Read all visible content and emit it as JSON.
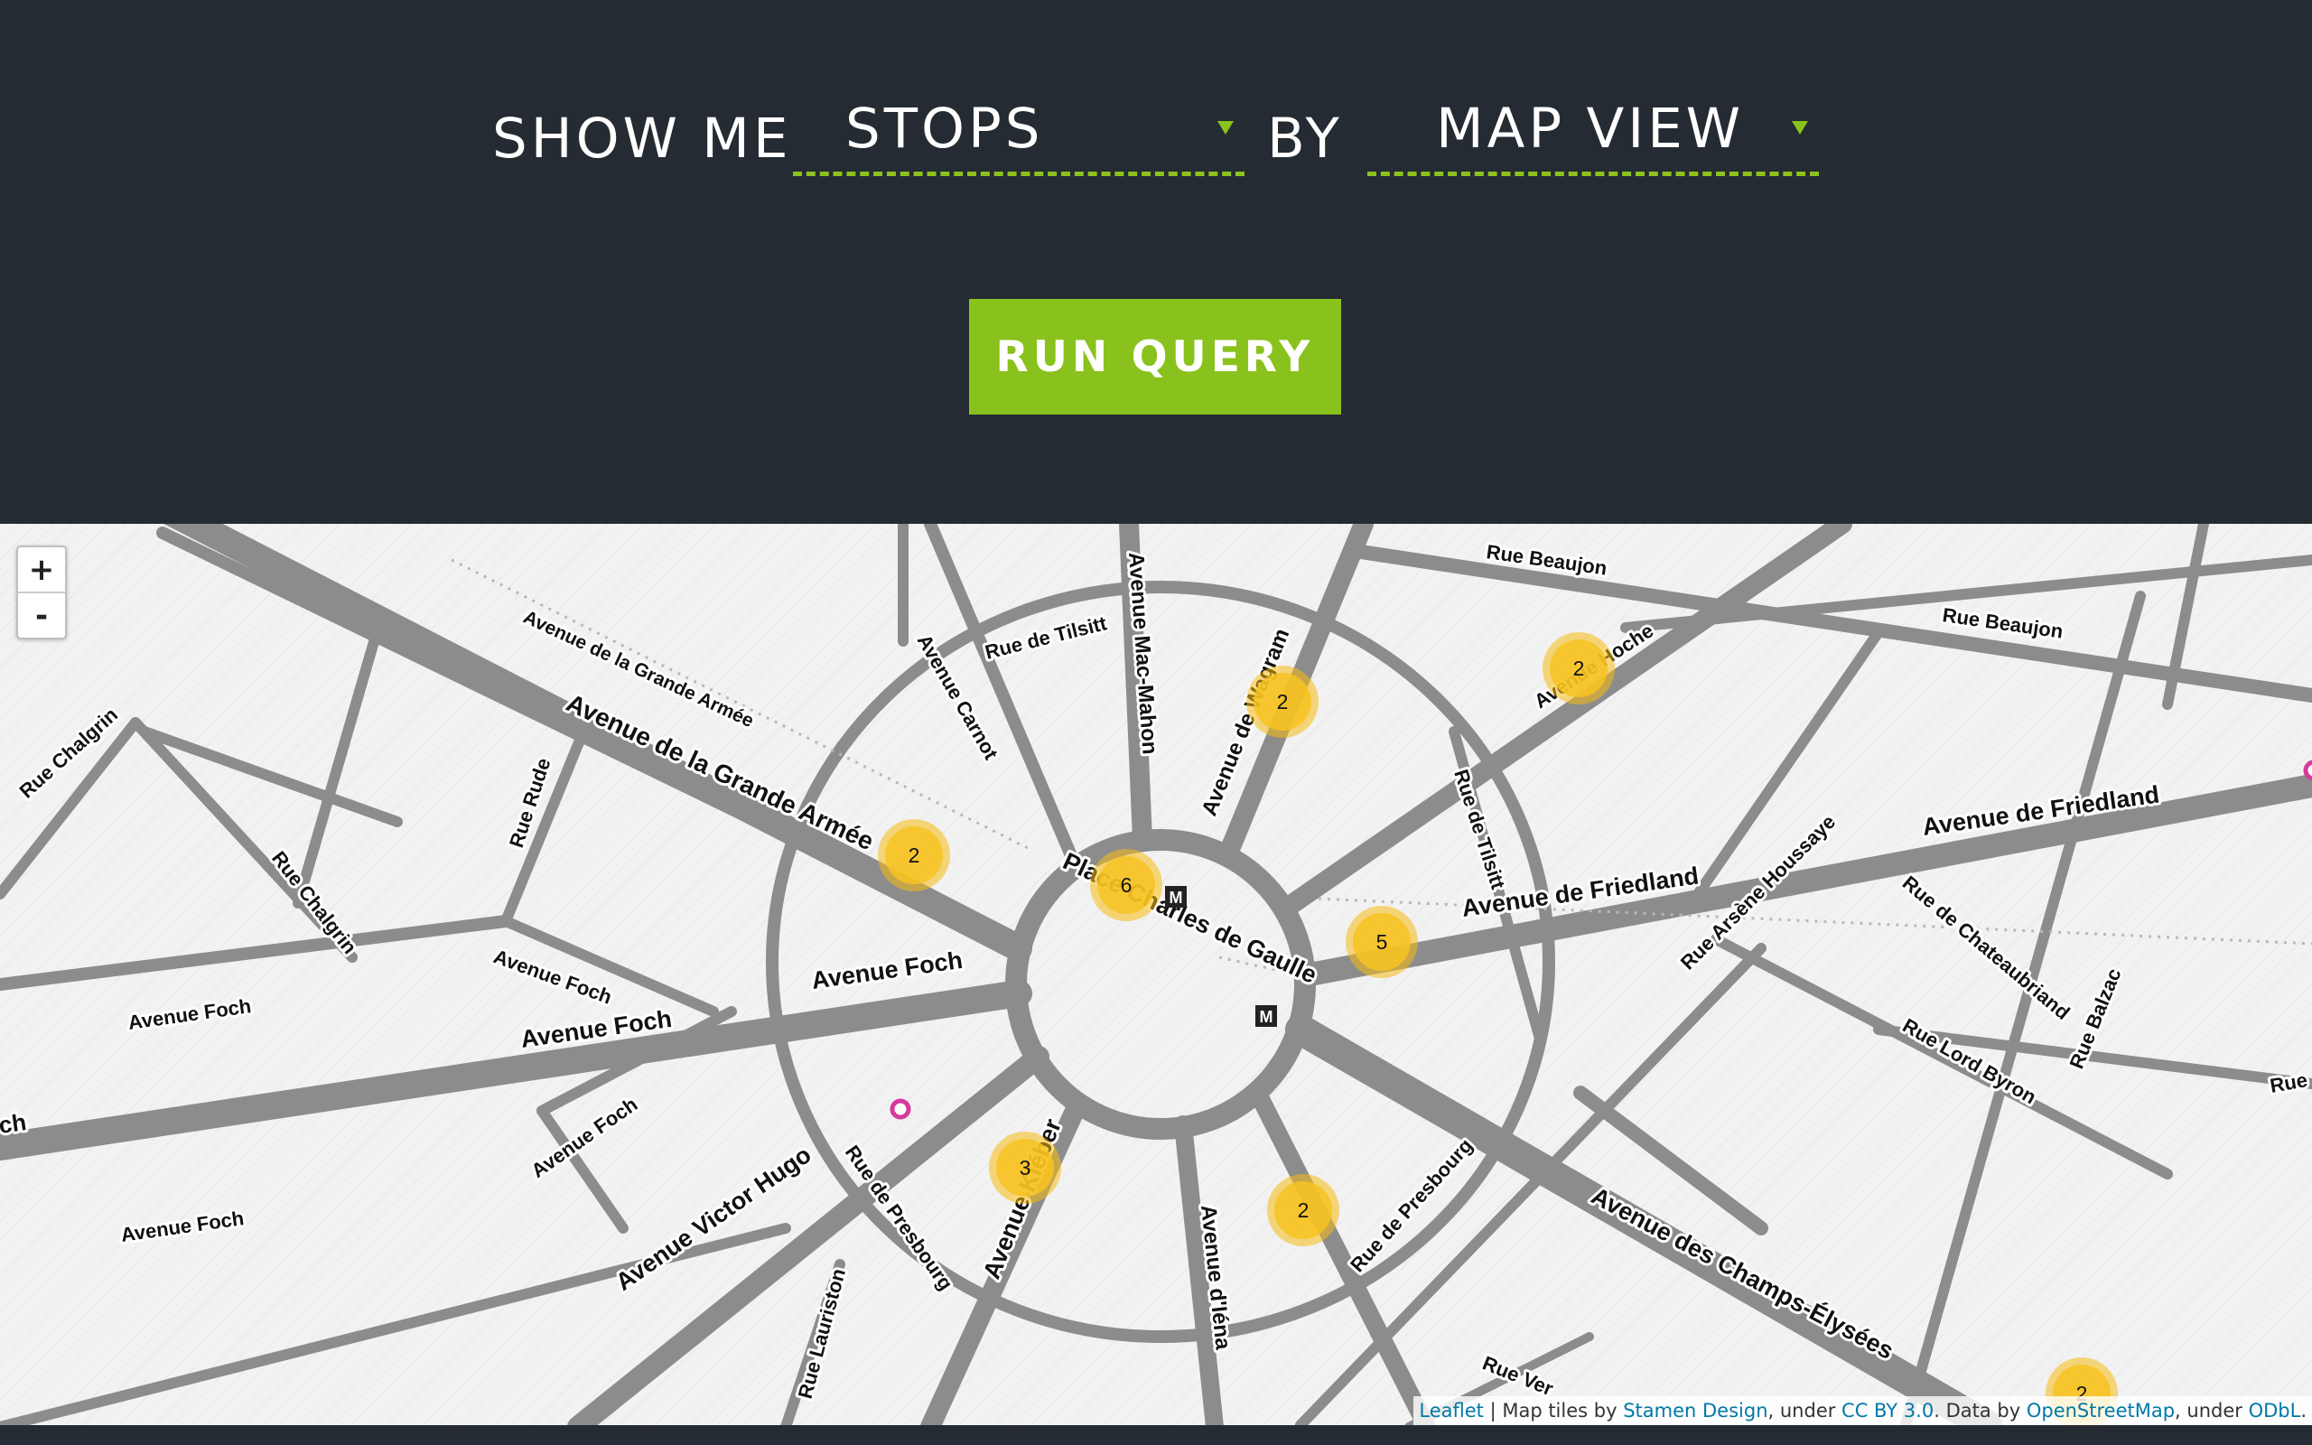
{
  "query": {
    "show_me_label": "SHOW ME",
    "subject_value": "STOPS",
    "by_label": "BY",
    "view_value": "MAP VIEW",
    "run_button_label": "RUN QUERY"
  },
  "map": {
    "zoom_in_label": "+",
    "zoom_out_label": "-",
    "street_labels": {
      "rue_beaujon_1": "Rue Beaujon",
      "rue_beaujon_2": "Rue Beaujon",
      "av_hoche": "Avenue Hoche",
      "av_wagram": "Avenue de Wagram",
      "av_mac_mahon": "Avenue Mac-Mahon",
      "rue_tilsitt_1": "Rue de Tilsitt",
      "rue_tilsitt_2": "Rue de Tilsitt",
      "av_carnot": "Avenue Carnot",
      "av_grande_armee_1": "Avenue de la Grande Armée",
      "av_grande_armee_2": "Avenue de la Grande Armée",
      "rue_chalgrin_1": "Rue Chalgrin",
      "rue_chalgrin_2": "Rue Chalgrin",
      "rue_rude": "Rue Rude",
      "place_cdg": "Place Charles de Gaulle",
      "av_friedland_1": "Avenue de Friedland",
      "av_friedland_2": "Avenue de Friedland",
      "rue_arsene_houssaye": "Rue Arsène Houssaye",
      "rue_chateaubriand": "Rue de Chateaubriand",
      "rue_balzac": "Rue Balzac",
      "rue_lord_byron": "Rue Lord Byron",
      "av_foch_1": "Avenue Foch",
      "av_foch_2": "Avenue Foch",
      "av_foch_3": "Avenue Foch",
      "av_foch_4": "Avenue Foch",
      "av_foch_5": "Avenue Foch",
      "av_foch_6": "Avenue Foch",
      "av_victor_hugo": "Avenue Victor Hugo",
      "rue_presbourg_1": "Rue de Presbourg",
      "rue_presbourg_2": "Rue de Presbourg",
      "av_kleber": "Avenue Kléber",
      "av_iena": "Avenue d'Iéna",
      "av_champs": "Avenue des Champs-Élysées",
      "rue_lauriston": "Rue Lauriston",
      "rue_vernet": "Rue Ver",
      "partial_ch": "ch",
      "partial_rue": "Rue",
      "metro_1": "M",
      "metro_2": "M"
    },
    "clusters": [
      {
        "id": "c1",
        "count": "2"
      },
      {
        "id": "c2",
        "count": "2"
      },
      {
        "id": "c3",
        "count": "2"
      },
      {
        "id": "c4",
        "count": "6"
      },
      {
        "id": "c5",
        "count": "5"
      },
      {
        "id": "c6",
        "count": "3"
      },
      {
        "id": "c7",
        "count": "2"
      },
      {
        "id": "c8",
        "count": "2"
      }
    ],
    "attribution": {
      "leaflet": "Leaflet",
      "sep": " | Map tiles by ",
      "stamen": "Stamen Design",
      "under1": ", under ",
      "ccby": "CC BY 3.0",
      "data_by": ". Data by ",
      "osm": "OpenStreetMap",
      "under2": ", under ",
      "odbl": "ODbL",
      "end": "."
    }
  },
  "colors": {
    "header_bg": "#252b33",
    "accent_green": "#89c21c",
    "cluster_yellow": "#f5bb12",
    "road_gray": "#8c8c8c",
    "marker_magenta": "#d63a9d"
  }
}
